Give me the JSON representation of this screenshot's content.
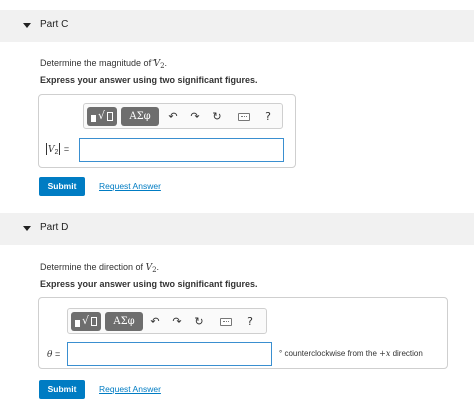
{
  "parts": [
    {
      "title": "Part C",
      "prompt_text": "Determine the magnitude of ",
      "prompt_var": "V",
      "prompt_sub": "2",
      "prompt_end": ".",
      "instruction": "Express your answer using two significant figures.",
      "answer_label": "V",
      "answer_label_sub": "2",
      "answer_label_eq": "=",
      "answer_value": "",
      "unit_text": "",
      "submit_label": "Submit",
      "request_label": "Request Answer"
    },
    {
      "title": "Part D",
      "prompt_text": "Determine the direction of ",
      "prompt_var": "V",
      "prompt_sub": "2",
      "prompt_end": ".",
      "instruction": "Express your answer using two significant figures.",
      "answer_label": "θ",
      "answer_label_eq": "=",
      "answer_value": "",
      "unit_degree": "°",
      "unit_text": "counterclockwise from the ",
      "unit_var": "+x",
      "unit_end": " direction",
      "submit_label": "Submit",
      "request_label": "Request Answer"
    }
  ],
  "toolbar": {
    "templates_radical": "√",
    "greek_label": "ΑΣφ",
    "undo_glyph": "↶",
    "redo_glyph": "↷",
    "reset_glyph": "↻",
    "help_glyph": "?"
  },
  "colors": {
    "header_bg": "#f1f1f1",
    "submit_bg": "#007cc3",
    "link": "#007cc3",
    "input_border": "#3a8fd0",
    "toolbar_button": "#6e6e6e"
  },
  "icons": [
    "caret-down-icon",
    "templates-icon",
    "greek-icon",
    "undo-icon",
    "redo-icon",
    "reset-icon",
    "keyboard-icon",
    "help-icon"
  ]
}
